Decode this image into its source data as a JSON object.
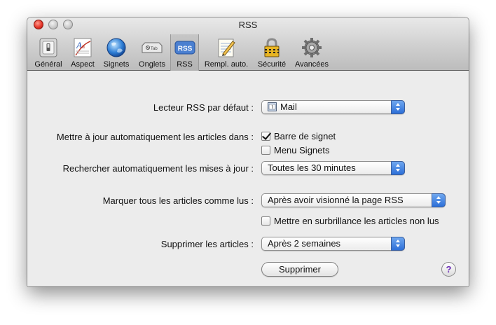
{
  "window": {
    "title": "RSS"
  },
  "toolbar": {
    "items": [
      {
        "label": "Général",
        "icon": "general-switch-icon"
      },
      {
        "label": "Aspect",
        "icon": "aspect-font-icon"
      },
      {
        "label": "Signets",
        "icon": "globe-icon"
      },
      {
        "label": "Onglets",
        "icon": "tab-icon"
      },
      {
        "label": "RSS",
        "icon": "rss-icon",
        "selected": true
      },
      {
        "label": "Rempl. auto.",
        "icon": "autofill-pencil-icon"
      },
      {
        "label": "Sécurité",
        "icon": "lock-icon"
      },
      {
        "label": "Avancées",
        "icon": "gear-icon"
      }
    ]
  },
  "settings": {
    "default_reader": {
      "label": "Lecteur RSS par défaut :",
      "value": "Mail"
    },
    "auto_update": {
      "label": "Mettre à jour automatiquement les articles dans :",
      "bookmarks_bar": {
        "label": "Barre de signet",
        "checked": true
      },
      "bookmarks_menu": {
        "label": "Menu Signets",
        "checked": false
      }
    },
    "check_updates": {
      "label": "Rechercher automatiquement les mises à jour :",
      "value": "Toutes les 30 minutes"
    },
    "mark_read": {
      "label": "Marquer tous les articles comme lus :",
      "value": "Après avoir visionné la page RSS"
    },
    "highlight_unread": {
      "label": "Mettre en surbrillance les articles non lus",
      "checked": false
    },
    "remove_articles": {
      "label": "Supprimer les articles :",
      "value": "Après 2 semaines"
    },
    "remove_button": "Supprimer",
    "help_button": "?"
  },
  "colors": {
    "accent_blue": "#2d6fd8",
    "rss_badge": "#4a7fd0",
    "help_purple": "#6b2bb5"
  }
}
